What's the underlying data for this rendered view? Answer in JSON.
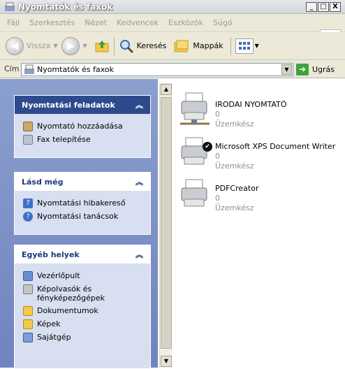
{
  "window": {
    "title": "Nyomtatók és faxok",
    "min": "_",
    "max": "□",
    "close": "X"
  },
  "menu": [
    "Fájl",
    "Szerkesztés",
    "Nézet",
    "Kedvencek",
    "Eszközök",
    "Súgó"
  ],
  "toolbar": {
    "back": "Vissza",
    "search": "Keresés",
    "folders": "Mappák"
  },
  "address": {
    "label": "Cím",
    "value": "Nyomtatók és faxok",
    "go": "Ugrás"
  },
  "tasks": {
    "title": "Nyomtatási feladatok",
    "items": [
      "Nyomtató hozzáadása",
      "Fax telepítése"
    ]
  },
  "seealso": {
    "title": "Lásd még",
    "items": [
      "Nyomtatási hibakereső",
      "Nyomtatási tanácsok"
    ]
  },
  "places": {
    "title": "Egyéb helyek",
    "items": [
      "Vezérlőpult",
      "Képolvasók és fényképezőgépek",
      "Dokumentumok",
      "Képek",
      "Sajátgép"
    ]
  },
  "printers": [
    {
      "name": "IRODAI NYOMTATÓ",
      "count": "0",
      "status": "Üzemkész"
    },
    {
      "name": "Microsoft XPS Document Writer",
      "count": "0",
      "status": "Üzemkész"
    },
    {
      "name": "PDFCreator",
      "count": "0",
      "status": "Üzemkész"
    }
  ]
}
